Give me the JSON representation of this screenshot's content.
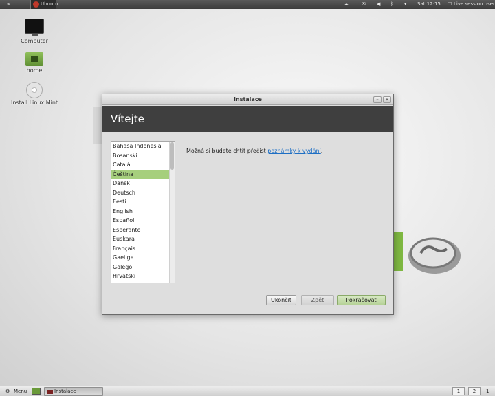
{
  "top_panel": {
    "left_icon": "∞",
    "app_label": "Ubuntu",
    "clock": "Sat 12:15",
    "user": "Live session user",
    "tray_icons": [
      "network-icon",
      "mail-icon",
      "volume-icon",
      "bluetooth-icon",
      "wifi-icon"
    ]
  },
  "desktop": {
    "icons": [
      {
        "label": "Computer",
        "icon": "computer-icon"
      },
      {
        "label": "home",
        "icon": "home-folder-icon"
      },
      {
        "label": "Install Linux Mint",
        "icon": "install-disc-icon"
      }
    ]
  },
  "window": {
    "title": "Instalace",
    "heading": "Vítejte",
    "languages": [
      "Bahasa Indonesia",
      "Bosanski",
      "Català",
      "Čeština",
      "Dansk",
      "Deutsch",
      "Eesti",
      "English",
      "Español",
      "Esperanto",
      "Euskara",
      "Français",
      "Gaeilge",
      "Galego",
      "Hrvatski"
    ],
    "selected_language": "Čeština",
    "intro_text": "Možná si budete chtít přečíst ",
    "intro_link": "poznámky k vydání",
    "intro_end": ".",
    "buttons": {
      "quit": "Ukončit",
      "back": "Zpět",
      "continue": "Pokračovat"
    }
  },
  "bottom_panel": {
    "menu_label": "Menu",
    "task_label": "Instalace",
    "workspaces": [
      "1",
      "2"
    ],
    "trailing": "1"
  }
}
